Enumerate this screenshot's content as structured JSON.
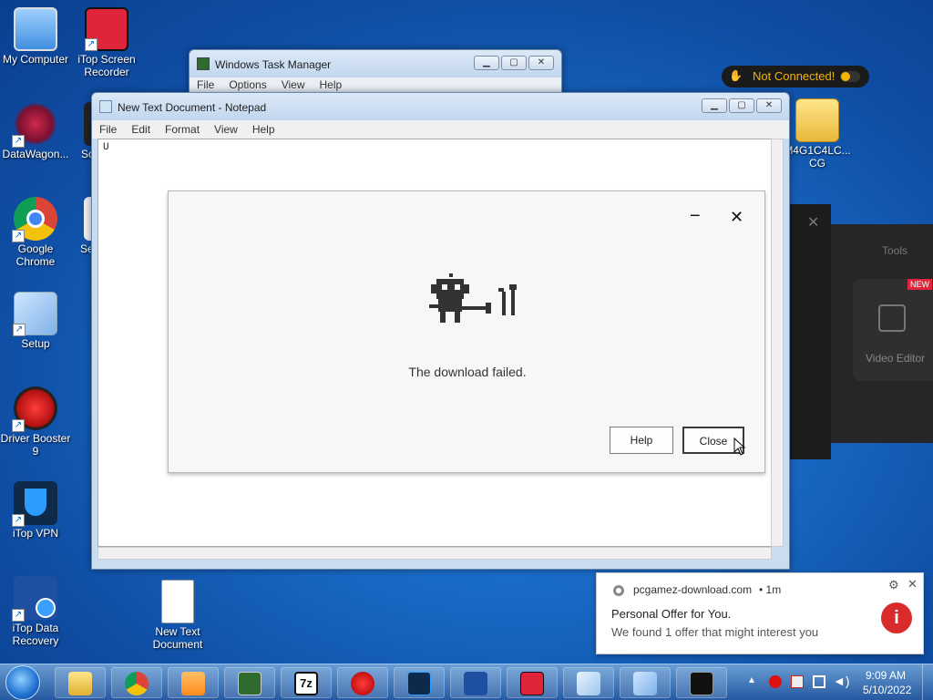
{
  "desktop": {
    "icons": [
      {
        "label": "My Computer"
      },
      {
        "label": "iTop Screen Recorder"
      },
      {
        "label": "DataWagon..."
      },
      {
        "label": "Sc"
      },
      {
        "label": "Google Chrome"
      },
      {
        "label": "Sea"
      },
      {
        "label": "Setup"
      },
      {
        "label": "Driver Booster 9"
      },
      {
        "label": "iTop VPN"
      },
      {
        "label": "iTop Data Recovery"
      },
      {
        "label": "New Text Document"
      },
      {
        "label": "M4G1C4LC... CG"
      }
    ]
  },
  "task_manager": {
    "title": "Windows Task Manager",
    "menu": [
      "File",
      "Options",
      "View",
      "Help"
    ]
  },
  "notepad": {
    "title": "New Text Document - Notepad",
    "menu": [
      "File",
      "Edit",
      "Format",
      "View",
      "Help"
    ],
    "content": "U"
  },
  "vpn_badge": {
    "text": "Not Connected!"
  },
  "dialog": {
    "minimize_glyph": "−",
    "close_glyph": "✕",
    "message": "The download failed.",
    "help_label": "Help",
    "close_label": "Close"
  },
  "bg_app": {
    "tools_label": "Tools",
    "new_badge": "NEW",
    "video_editor_label": "Video Editor",
    "close_glyph": "✕"
  },
  "notification": {
    "source": "pcgamez-download.com",
    "age": "• 1m",
    "title": "Personal Offer for You.",
    "body": "We found 1 offer that might interest you"
  },
  "taskbar": {
    "time": "9:09 AM",
    "date": "5/10/2022",
    "items": [
      "file-explorer",
      "chrome",
      "media-player",
      "task-manager",
      "7zip",
      "driver-booster",
      "itop-vpn",
      "itop-data-recovery",
      "itop-screen-recorder",
      "notepad",
      "setup",
      "cmd"
    ],
    "sevenzip_text": "7z"
  },
  "colors": {
    "desktop_bg": "#1a6cc8",
    "vpn_dot": "#f5b400",
    "notif_icon": "#d92b2b"
  }
}
